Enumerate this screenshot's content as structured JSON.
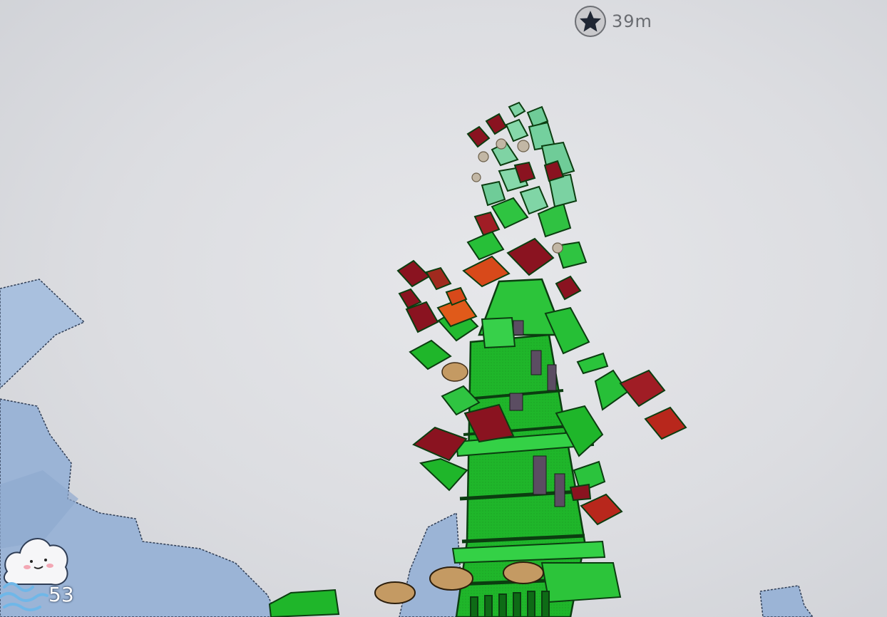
{
  "hud": {
    "height_value": "39m",
    "height_icon": "star-icon",
    "cloud_icon": "cloud-mascot-icon",
    "cloud_count": "53"
  },
  "colors": {
    "sky": "#dcdde1",
    "terrain": "#9db6d8",
    "tower_green": "#1fb62a",
    "crate_red": "#8a1320",
    "crate_orange": "#d8491a",
    "crate_mint": "#7fd3a4",
    "plate_tan": "#c49a63"
  }
}
